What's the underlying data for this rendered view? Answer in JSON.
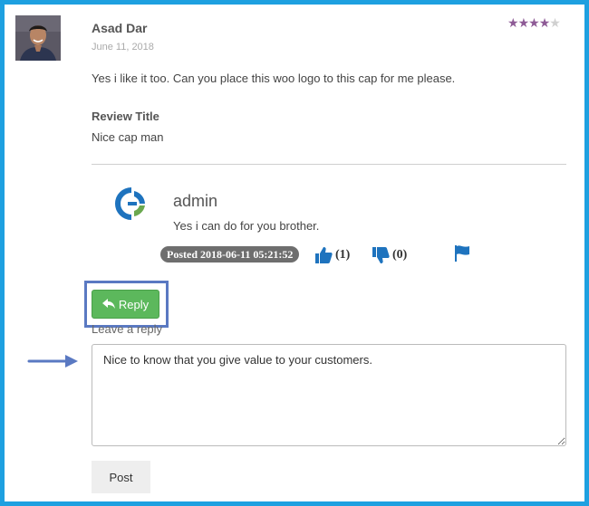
{
  "review": {
    "author": "Asad Dar",
    "date": "June 11, 2018",
    "rating": 4,
    "rating_max": 5,
    "text": "Yes i like it too. Can you place this woo logo to this cap for me please.",
    "title_label": "Review Title",
    "title_value": "Nice cap man"
  },
  "reply_comment": {
    "author": "admin",
    "text": "Yes i can do for you brother.",
    "posted": "Posted 2018-06-11 05:21:52",
    "likes": "(1)",
    "dislikes": "(0)"
  },
  "reply_form": {
    "reply_button_label": "Reply",
    "leave_reply_label": "Leave a reply",
    "textarea_value": "Nice to know that you give value to your customers.",
    "post_button_label": "Post"
  },
  "colors": {
    "frame": "#1ea0e0",
    "star_on": "#8e5b96",
    "star_off": "#d0d0d0",
    "vote_icon": "#1e73be",
    "reply_button": "#5cb85c",
    "highlight": "#5a79c2",
    "logo_blue": "#1e73be",
    "logo_green": "#6aa84f"
  },
  "icons": {
    "like": "thumbs-up-icon",
    "dislike": "thumbs-down-icon",
    "flag": "flag-icon",
    "reply": "reply-arrow-icon",
    "pointer": "arrow-right-icon"
  }
}
